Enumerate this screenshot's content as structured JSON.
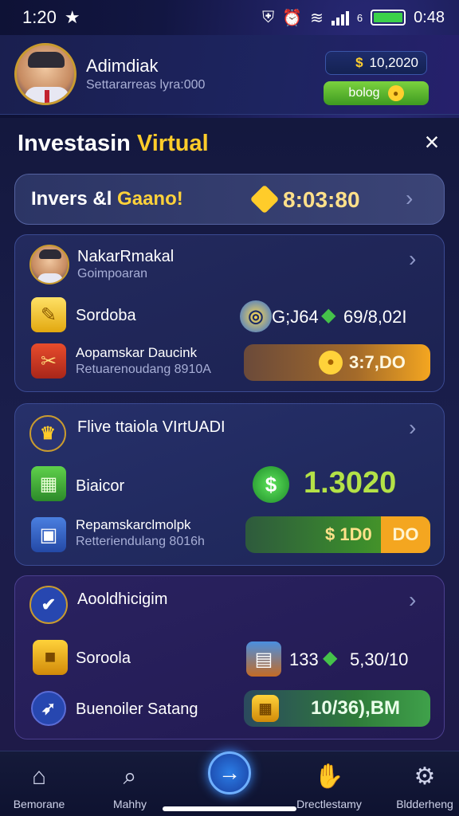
{
  "status_bar": {
    "time": "1:20",
    "battery_level": "6",
    "clock": "0:48"
  },
  "header": {
    "user_name": "Adimdiak",
    "user_sub": "Settararreas lyra:000",
    "balance": "10,2020",
    "balance_currency_icon": "$",
    "bolog_button": "bolog"
  },
  "panel": {
    "title_white": "Investasin ",
    "title_accent": "Virtual",
    "close_icon": "×"
  },
  "banner": {
    "label_part1": "Invers &l ",
    "label_part2": "Gaano!",
    "value": "8:03:80"
  },
  "card1": {
    "title": "NakarRmakal",
    "subtitle": "Goimpoaran",
    "row1_label": "Sordoba",
    "row1_value_a": "G;J64",
    "row1_value_b": "69/8,02I",
    "row2_label": "Aopamskar Daucink",
    "row2_sub": "Retuarenoudang 8910A",
    "pill_value": "3:7,DO"
  },
  "card2": {
    "title": "Flive ttaiola VIrtUADI",
    "row1_label": "Biaicor",
    "big_value": "1.3020",
    "row2_label": "Repamskarclmolpk",
    "row2_sub": "Retteriendulang 8016h",
    "pill_value_a": "$ 1D0",
    "pill_value_b": "DO"
  },
  "card3": {
    "title": "Aooldhicigim",
    "row1_label": "Soroola",
    "row1_value_a": "133",
    "row1_value_b": "5,30/10",
    "row2_label": "Buenoiler Satang",
    "pill_value": "10/36),BM"
  },
  "bottom_nav": {
    "items": [
      {
        "label": "Bemorane",
        "icon": "home-icon"
      },
      {
        "label": "Mahhy",
        "icon": "search-icon"
      },
      {
        "label": "Drectlestamy",
        "icon": "user-icon"
      },
      {
        "label": "Bldderheng",
        "icon": "settings-icon"
      }
    ],
    "center_icon": "→"
  }
}
